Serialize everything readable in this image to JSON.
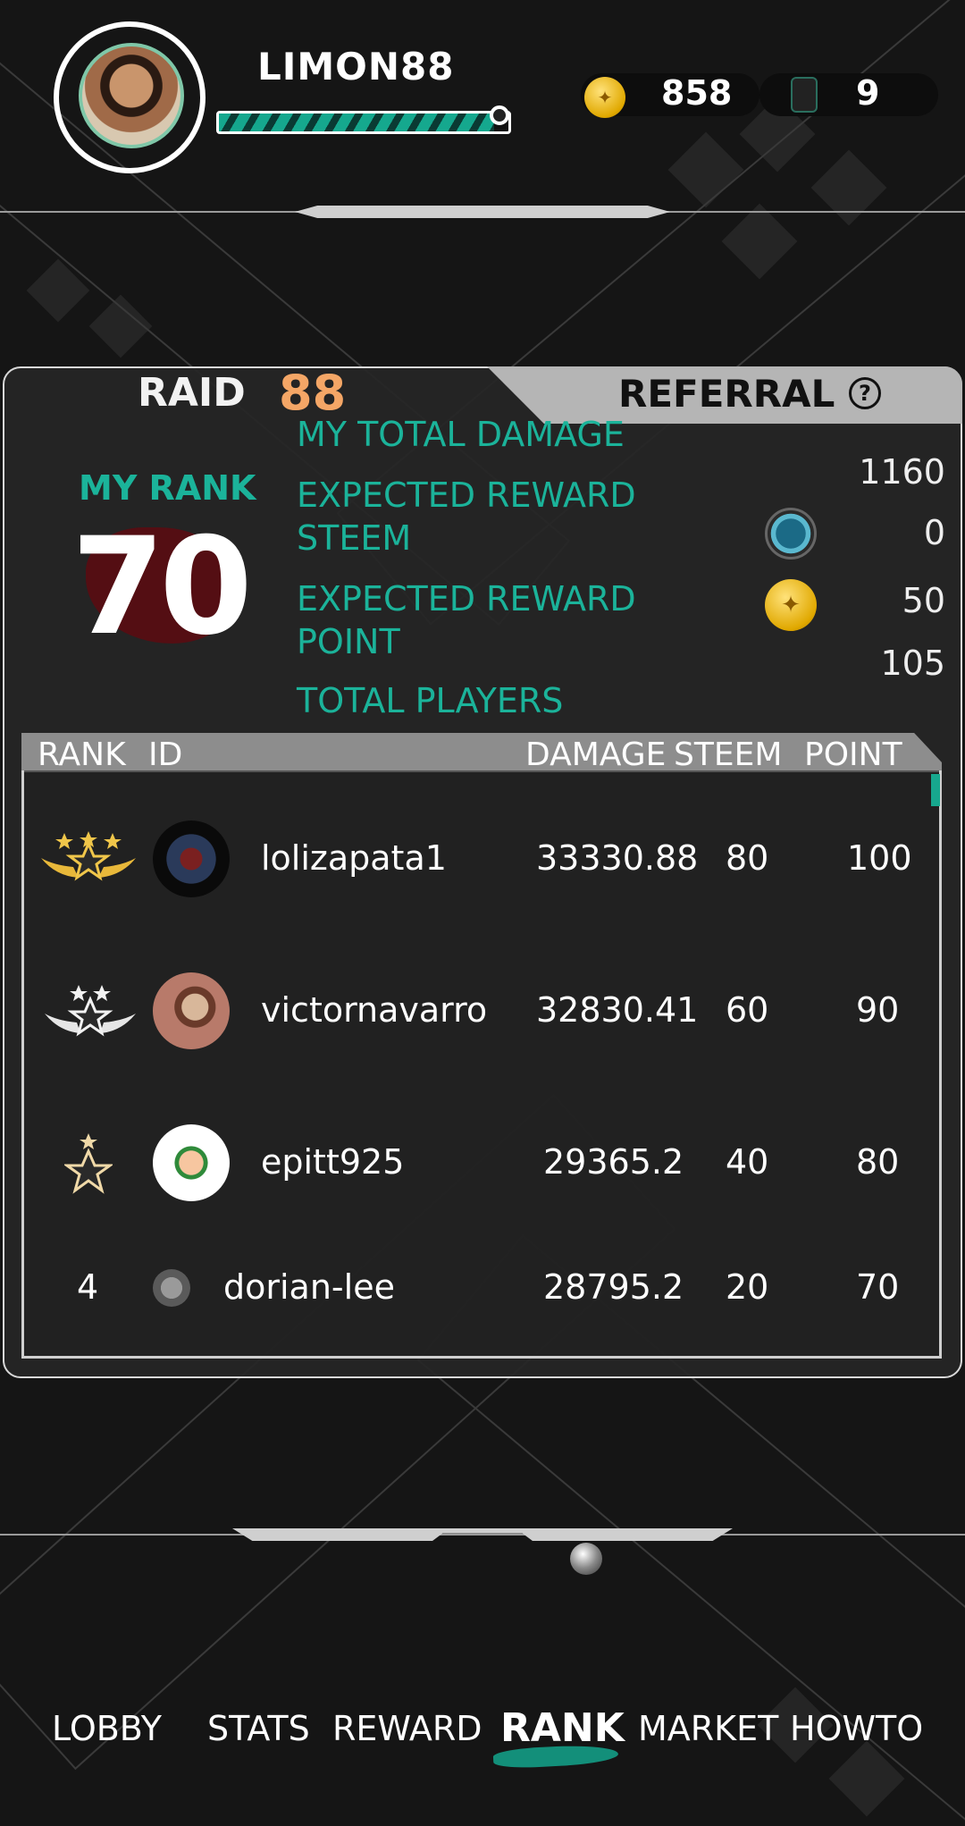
{
  "header": {
    "username": "LIMON88",
    "hp_fraction": 0.95,
    "coins": "858",
    "tickets": "9"
  },
  "panel": {
    "tab_raid_label": "RAID",
    "tab_raid_number": "88",
    "tab_referral_label": "REFERRAL",
    "help_glyph": "?",
    "my_rank_label": "MY RANK",
    "my_rank_value": "70",
    "stats": {
      "total_damage_label": "MY TOTAL DAMAGE",
      "total_damage_value": "1160",
      "steem_label_1": "EXPECTED REWARD",
      "steem_label_2": "STEEM",
      "steem_value": "0",
      "point_label_1": "EXPECTED REWARD",
      "point_label_2": "POINT",
      "point_value": "50",
      "players_label": "TOTAL PLAYERS",
      "players_value": "105"
    }
  },
  "table": {
    "headers": {
      "rank": "RANK",
      "id": "ID",
      "damage": "DAMAGE",
      "steem": "STEEM",
      "point": "POINT"
    },
    "rows": [
      {
        "rank": "1",
        "id": "lolizapata1",
        "damage": "33330.88",
        "steem": "80",
        "point": "100"
      },
      {
        "rank": "2",
        "id": "victornavarro",
        "damage": "32830.41",
        "steem": "60",
        "point": "90"
      },
      {
        "rank": "3",
        "id": "epitt925",
        "damage": "29365.2",
        "steem": "40",
        "point": "80"
      },
      {
        "rank": "4",
        "id": "dorian-lee",
        "damage": "28795.2",
        "steem": "20",
        "point": "70"
      }
    ]
  },
  "nav": {
    "lobby": "LOBBY",
    "stats": "STATS",
    "reward": "REWARD",
    "rank": "RANK",
    "market": "MARKET",
    "howto": "HOWTO",
    "active": "rank"
  },
  "colors": {
    "accent_teal": "#1bb39a",
    "raid_orange": "#f4a666",
    "gold": "#e0a800"
  },
  "icons": [
    "coin-icon",
    "ticket-icon",
    "help-icon",
    "steem-icon",
    "rank-badge-gold",
    "rank-badge-silver",
    "rank-badge-bronze"
  ]
}
